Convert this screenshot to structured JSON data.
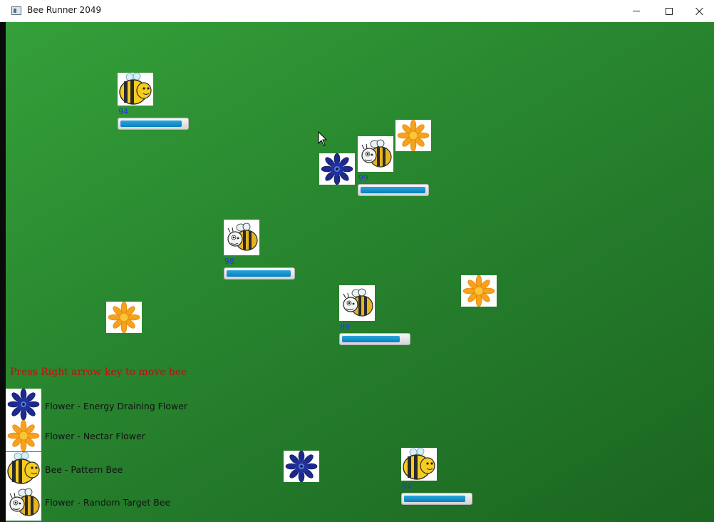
{
  "window": {
    "title": "Bee Runner 2049",
    "icon": "app-window-icon",
    "controls": [
      "minimize-icon",
      "maximize-icon",
      "close-icon"
    ]
  },
  "colors": {
    "field_light": "#35a03a",
    "field_dark": "#1b6520",
    "energy_fill": "#1690cf",
    "energy_label": "#1f3fd0",
    "instruction": "#c40d0d"
  },
  "instruction": "Press Right arrow key to move bee",
  "legend": [
    {
      "sprite": "energy-draining-flower",
      "label": "Flower - Energy Draining Flower"
    },
    {
      "sprite": "nectar-flower",
      "label": "Flower - Nectar Flower"
    },
    {
      "sprite": "pattern-bee",
      "label": "Bee - Pattern Bee"
    },
    {
      "sprite": "random-target-bee",
      "label": "Flower - Random Target Bee"
    }
  ],
  "bees": [
    {
      "kind": "pattern-bee",
      "energy": "94",
      "level": 0.94
    },
    {
      "kind": "random-target-bee",
      "energy": "99",
      "level": 0.99
    },
    {
      "kind": "random-target-bee",
      "energy": "98",
      "level": 0.98
    },
    {
      "kind": "random-target-bee",
      "energy": "88",
      "level": 0.88
    },
    {
      "kind": "pattern-bee",
      "energy": "94",
      "level": 0.94
    }
  ],
  "flowers": [
    {
      "kind": "nectar-flower"
    },
    {
      "kind": "energy-draining-flower"
    },
    {
      "kind": "nectar-flower"
    },
    {
      "kind": "nectar-flower"
    },
    {
      "kind": "energy-draining-flower"
    }
  ]
}
